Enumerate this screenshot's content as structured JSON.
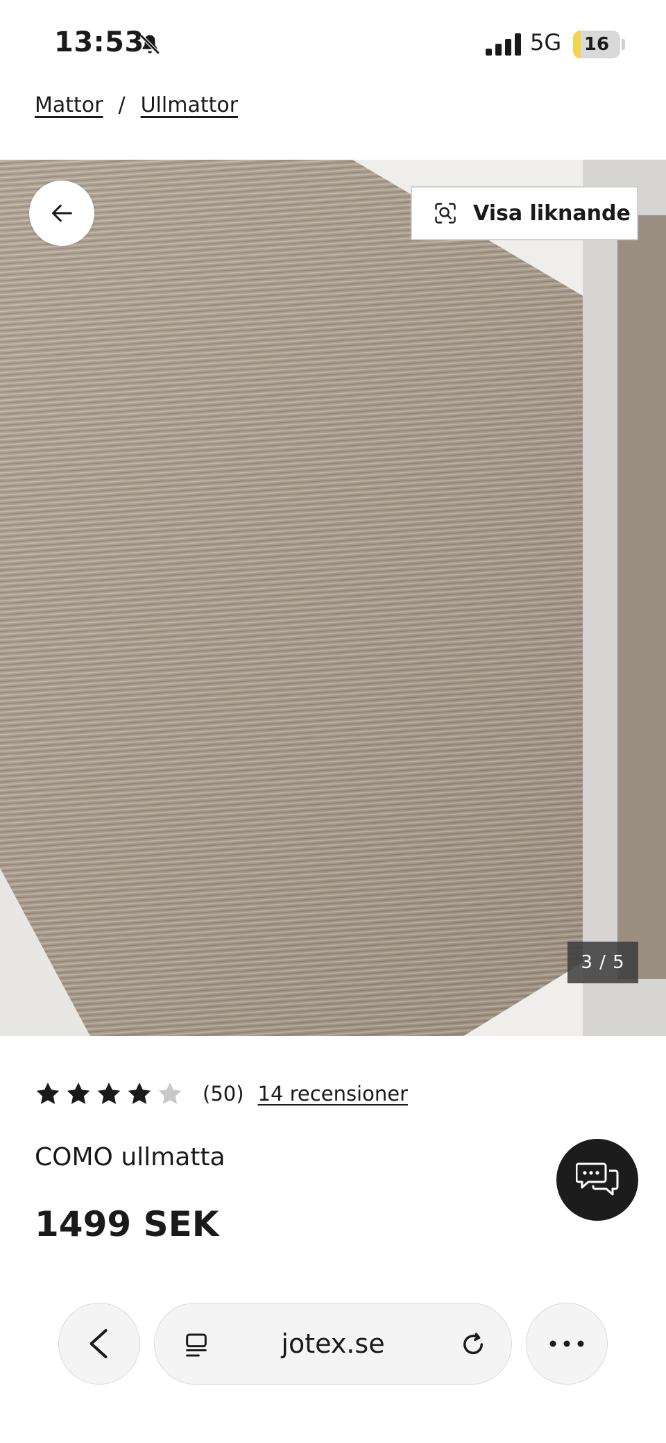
{
  "status_bar": {
    "time": "13:53",
    "network": "5G",
    "battery_level": "16",
    "battery_fraction": 0.16,
    "icons": [
      "bell-slash-icon",
      "cellular-signal-icon",
      "battery-icon"
    ]
  },
  "breadcrumb": {
    "items": [
      {
        "label": "Mattor"
      },
      {
        "label": "Ullmattor"
      }
    ],
    "separator": "/"
  },
  "gallery": {
    "back_icon": "arrow-left-icon",
    "similar_button_label": "Visa liknande",
    "similar_icon": "visual-search-icon",
    "counter": "3 / 5"
  },
  "product": {
    "rating_value": 4,
    "rating_max": 5,
    "rating_count": "(50)",
    "reviews_link": "14 recensioner",
    "title": "COMO ullmatta",
    "price": "1499 SEK"
  },
  "chat": {
    "icon": "chat-bubbles-icon"
  },
  "browser": {
    "url": "jotex.se",
    "back_icon": "chevron-left-icon",
    "reader_icon": "reader-mode-icon",
    "reload_icon": "reload-icon",
    "more_icon": "more-icon"
  },
  "colors": {
    "text": "#1a1a1a",
    "star_filled": "#1a1a1a",
    "star_empty": "#c8c8c8",
    "battery": "#f2d34a",
    "chat_bg": "#1c1c1c",
    "rug": "#a89a8a"
  }
}
